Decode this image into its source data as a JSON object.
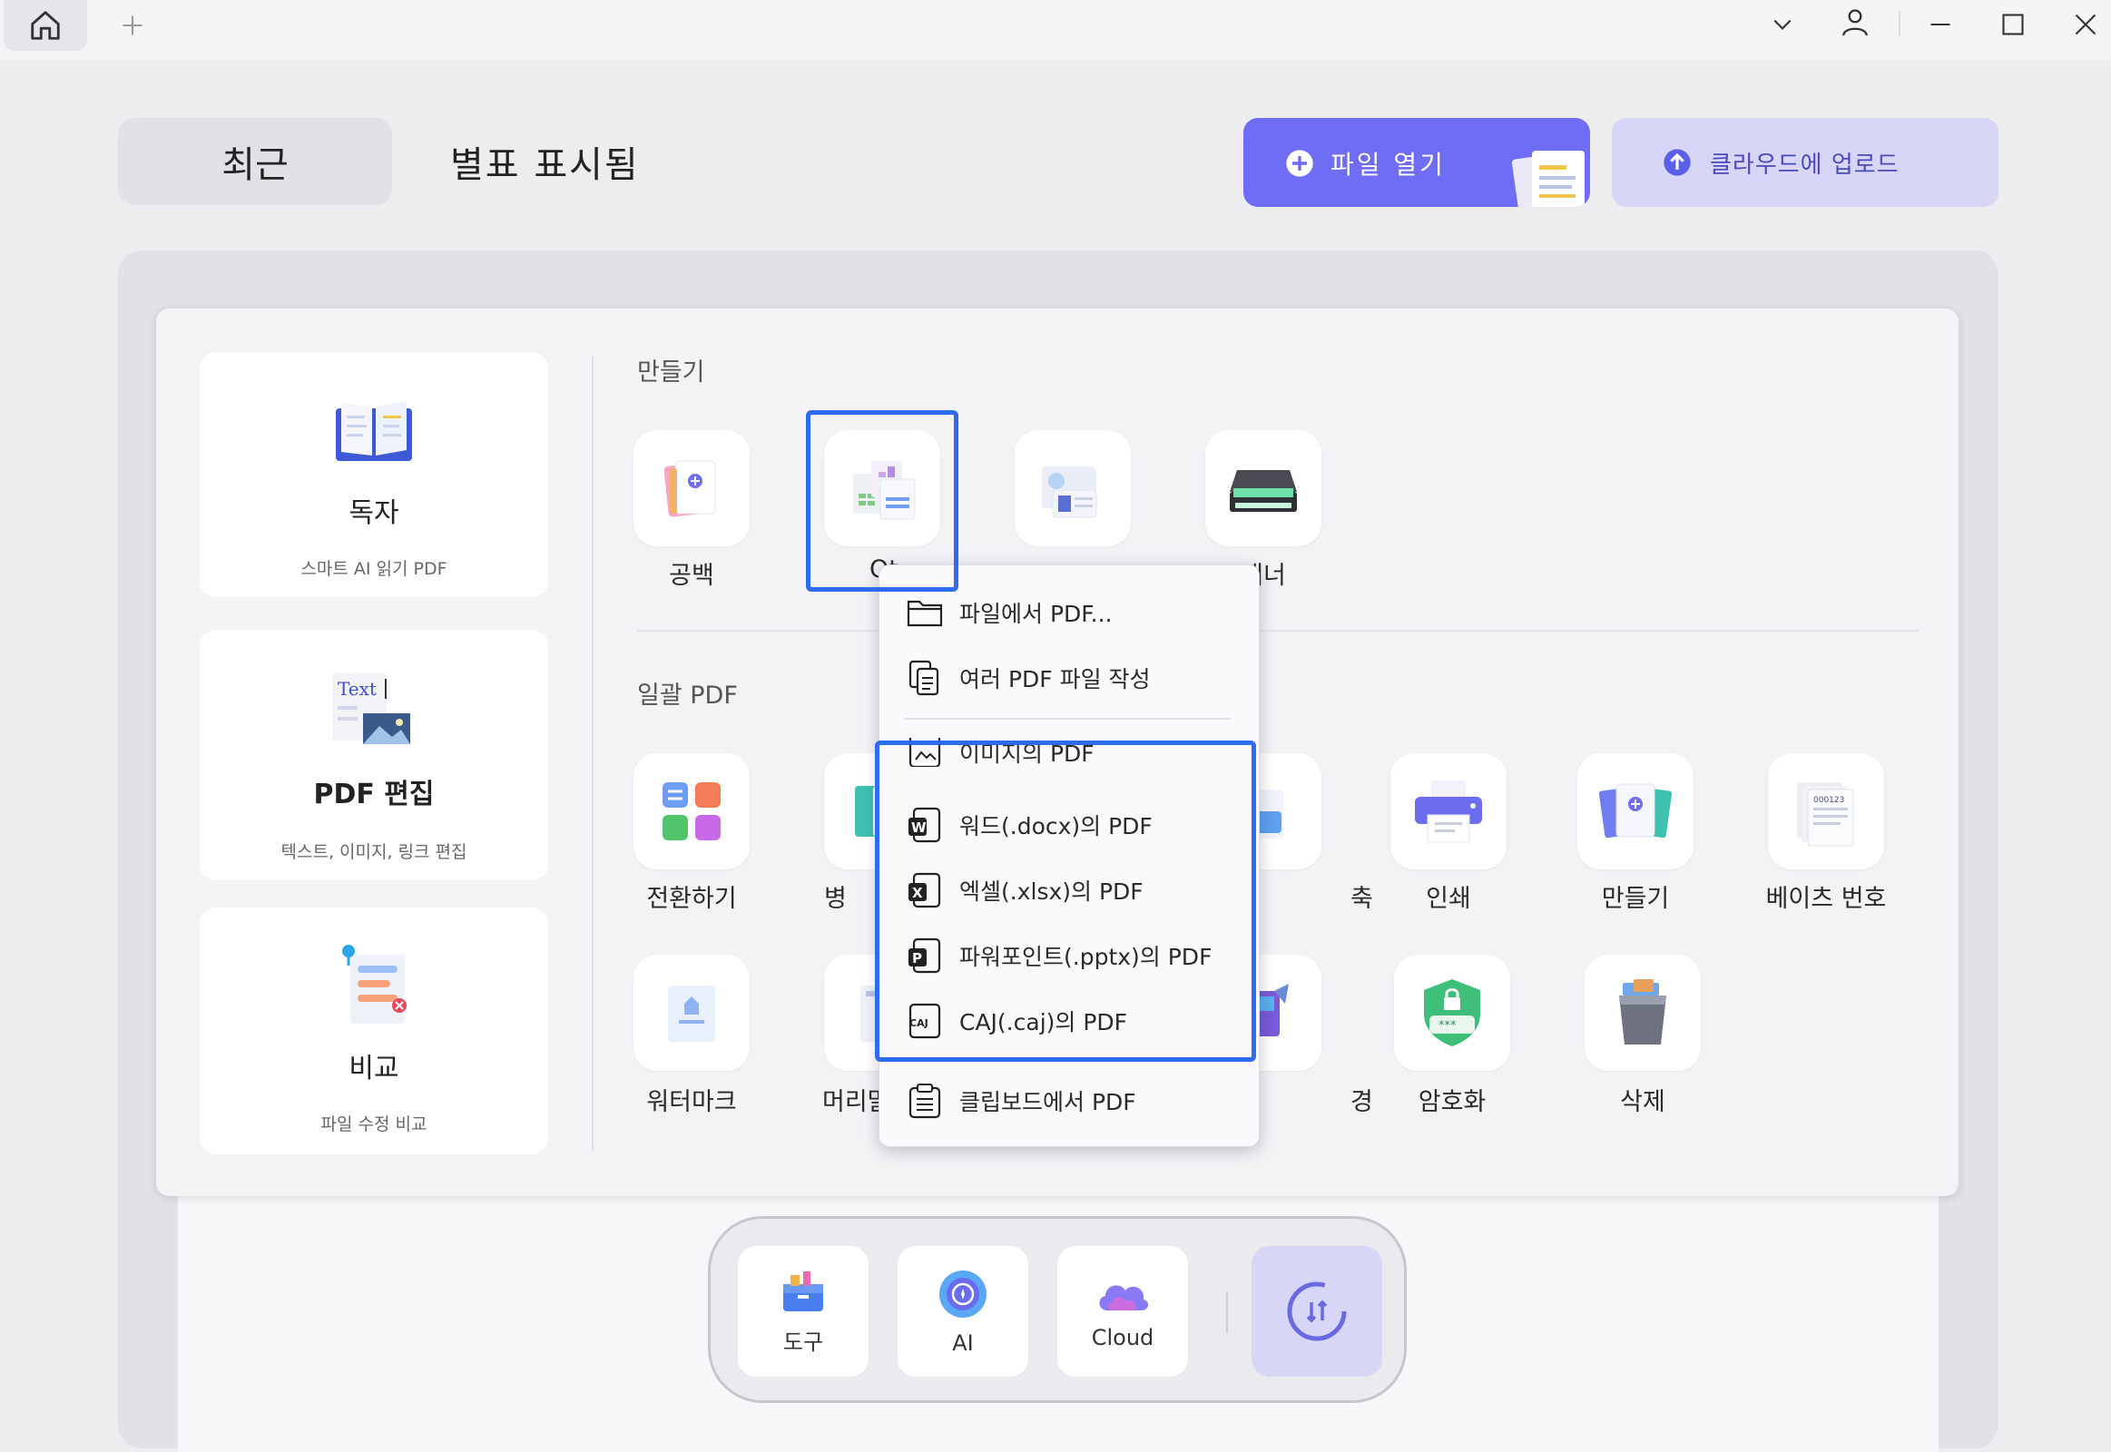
{
  "titlebar": {
    "icons": [
      "home-icon",
      "plus-icon",
      "chevron-down-icon",
      "user-icon",
      "minimize-icon",
      "maximize-icon",
      "close-icon"
    ]
  },
  "tabs": {
    "recent": "최근",
    "starred": "별표 표시됨"
  },
  "actions": {
    "open_file": "파일 열기",
    "upload_cloud": "클라우드에 업로드"
  },
  "cards": [
    {
      "title": "독자",
      "subtitle": "스마트 AI 읽기 PDF",
      "icon": "book-icon"
    },
    {
      "title": "PDF 편집",
      "subtitle": "텍스트, 이미지, 링크 편집",
      "icon": "edit-text-icon",
      "icon_text": "Text"
    },
    {
      "title": "비교",
      "subtitle": "파일 수정 비교",
      "icon": "compare-icon"
    }
  ],
  "create": {
    "section_title": "만들기",
    "items": [
      {
        "label": "공백",
        "icon": "blank-page-icon"
      },
      {
        "label": "Ot",
        "icon": "other-files-icon"
      },
      {
        "label": "...",
        "icon": "template-icon"
      },
      {
        "label": "캐너",
        "icon": "scanner-icon"
      }
    ]
  },
  "batch": {
    "section_title": "일괄 PDF",
    "row1": [
      {
        "label": "전환하기",
        "icon": "convert-icon"
      },
      {
        "label": "병",
        "icon": "merge-icon"
      },
      {
        "label": "축",
        "icon": "compress-icon"
      },
      {
        "label": "인쇄",
        "icon": "printer-icon"
      },
      {
        "label": "만들기",
        "icon": "create-batch-icon"
      },
      {
        "label": "베이츠 번호",
        "icon": "bates-number-icon",
        "icon_text": "000123"
      }
    ],
    "row2": [
      {
        "label": "워터마크",
        "icon": "watermark-icon"
      },
      {
        "label": "머리말",
        "icon": "header-icon"
      },
      {
        "label": "경",
        "icon": "background-icon"
      },
      {
        "label": "암호화",
        "icon": "encrypt-icon",
        "icon_text": "***"
      },
      {
        "label": "삭제",
        "icon": "trash-icon"
      }
    ]
  },
  "dropdown": {
    "items": [
      {
        "label": "파일에서 PDF...",
        "icon": "folder-icon"
      },
      {
        "label": "여러 PDF 파일 작성",
        "icon": "multi-file-icon"
      },
      {
        "label": "이미지의 PDF",
        "icon": "image-file-icon"
      },
      {
        "label": "워드(.docx)의 PDF",
        "icon": "word-icon",
        "badge": "W"
      },
      {
        "label": "엑셀(.xlsx)의 PDF",
        "icon": "excel-icon",
        "badge": "X"
      },
      {
        "label": "파워포인트(.pptx)의 PDF",
        "icon": "powerpoint-icon",
        "badge": "P"
      },
      {
        "label": "CAJ(.caj)의 PDF",
        "icon": "caj-icon",
        "badge": "CAJ"
      },
      {
        "label": "클립보드에서 PDF",
        "icon": "clipboard-icon"
      }
    ]
  },
  "dock": [
    {
      "label": "도구",
      "icon": "toolbox-icon"
    },
    {
      "label": "AI",
      "icon": "ai-icon"
    },
    {
      "label": "Cloud",
      "icon": "cloud-icon"
    },
    {
      "label": "",
      "icon": "sync-icon"
    }
  ],
  "colors": {
    "accent": "#6f6cf5",
    "highlight": "#2d6cf0",
    "upload_bg": "#d7d6f6"
  }
}
